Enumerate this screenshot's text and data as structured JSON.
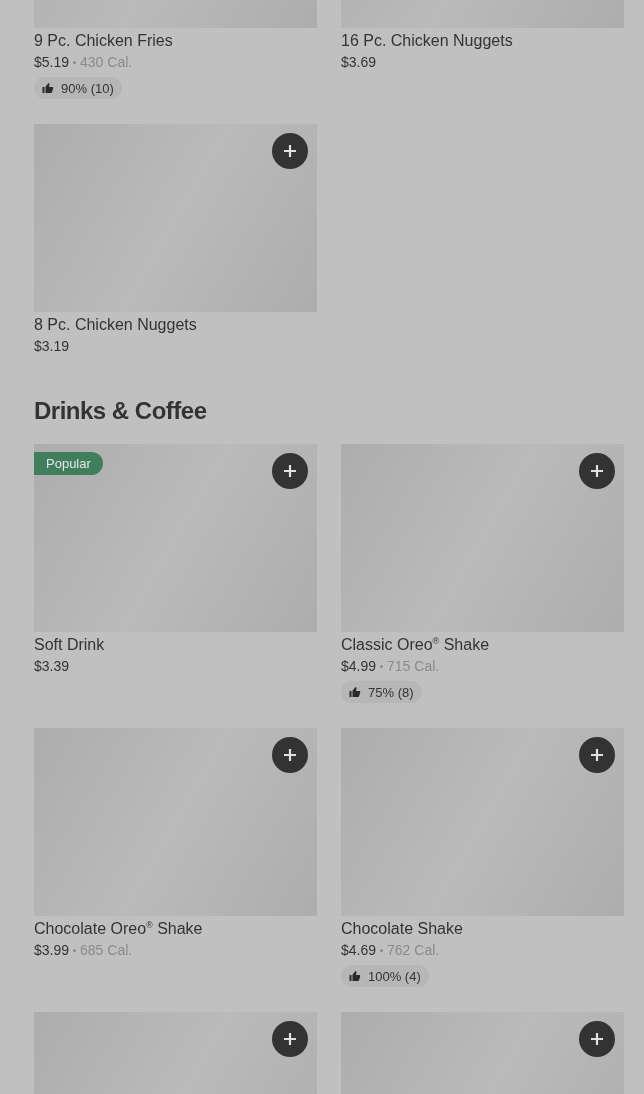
{
  "sections": [
    {
      "items": [
        {
          "kind": "cropped",
          "name": "9 Pc. Chicken Fries",
          "price": "$5.19",
          "calories": "430 Cal.",
          "rating": "90% (10)"
        },
        {
          "kind": "cropped",
          "name": "16 Pc. Chicken Nuggets",
          "price": "$3.69"
        },
        {
          "kind": "full",
          "name": "8 Pc. Chicken Nuggets",
          "price": "$3.19"
        }
      ]
    },
    {
      "title": "Drinks & Coffee",
      "items": [
        {
          "kind": "full",
          "name": "Soft Drink",
          "price": "$3.39",
          "badge": "Popular"
        },
        {
          "kind": "full",
          "name": "Classic Oreo$^{®}$ Shake",
          "price": "$4.99",
          "calories": "715 Cal.",
          "rating": "75% (8)"
        },
        {
          "kind": "full",
          "name": "Chocolate Oreo$^{®}$ Shake",
          "price": "$3.99",
          "calories": "685 Cal."
        },
        {
          "kind": "full",
          "name": "Chocolate Shake",
          "price": "$4.69",
          "calories": "762 Cal.",
          "rating": "100% (4)"
        },
        {
          "kind": "partial"
        },
        {
          "kind": "partial"
        }
      ]
    }
  ]
}
